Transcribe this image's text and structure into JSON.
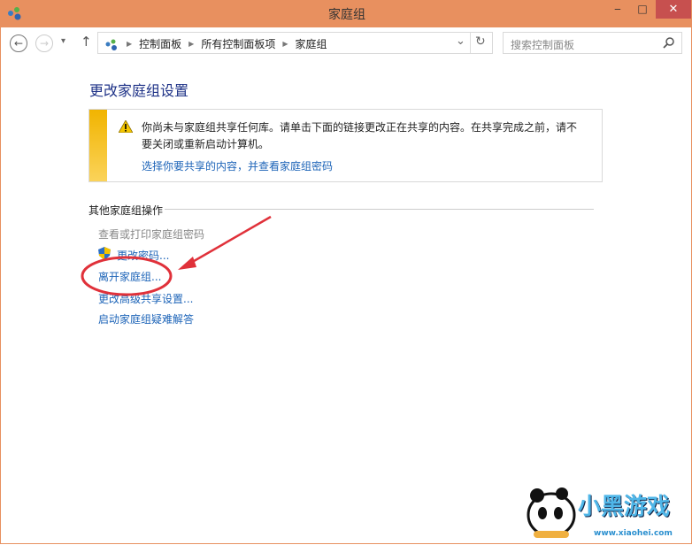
{
  "window": {
    "title": "家庭组",
    "minimize": "‒",
    "maximize": "□",
    "close": "✕"
  },
  "nav": {
    "back": "←",
    "forward": "→",
    "recent": "▾",
    "up": "↑",
    "refresh": "↻",
    "dropdown": "⌄"
  },
  "breadcrumb": [
    "控制面板",
    "所有控制面板项",
    "家庭组"
  ],
  "search": {
    "placeholder": "搜索控制面板"
  },
  "page": {
    "heading": "更改家庭组设置",
    "warning": {
      "text": "你尚未与家庭组共享任何库。请单击下面的链接更改正在共享的内容。在共享完成之前，请不要关闭或重新启动计算机。",
      "link": "选择你要共享的内容，并查看家庭组密码"
    },
    "section": "其他家庭组操作",
    "actions": [
      "查看或打印家庭组密码",
      "更改密码...",
      "离开家庭组...",
      "更改高级共享设置...",
      "启动家庭组疑难解答"
    ]
  },
  "watermark": {
    "brand": "小黑游戏",
    "url": "www.xiaohei.com"
  },
  "colors": {
    "titlebar": "#e8905f",
    "close": "#c7504f",
    "link": "#1d64b8",
    "annotation": "#e0313a"
  }
}
